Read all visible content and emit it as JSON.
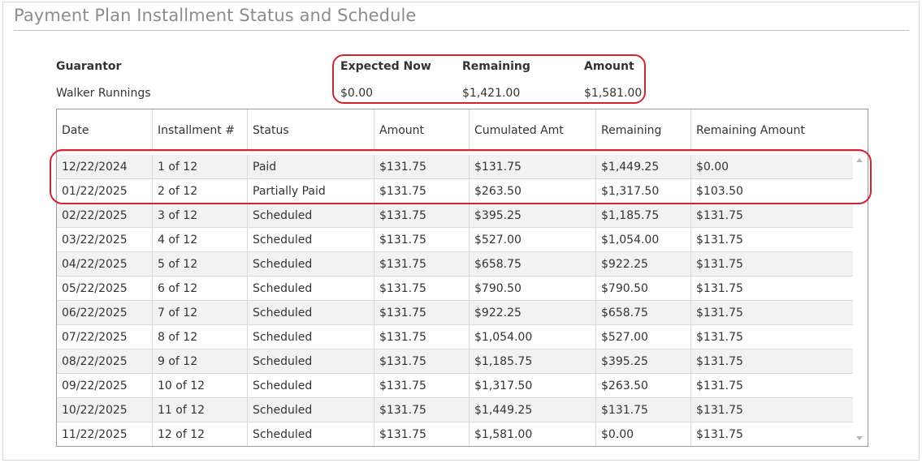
{
  "page": {
    "title": "Payment Plan Installment Status and Schedule"
  },
  "summary": {
    "guarantor_label": "Guarantor",
    "guarantor_value": "Walker Runnings",
    "expected_now_label": "Expected Now",
    "expected_now_value": "$0.00",
    "remaining_label": "Remaining",
    "remaining_value": "$1,421.00",
    "amount_label": "Amount",
    "amount_value": "$1,581.00"
  },
  "table": {
    "columns": [
      "Date",
      "Installment #",
      "Status",
      "Amount",
      "Cumulated Amt",
      "Remaining",
      "Remaining Amount"
    ],
    "rows": [
      [
        "12/22/2024",
        "1 of 12",
        "Paid",
        "$131.75",
        "$131.75",
        "$1,449.25",
        "$0.00"
      ],
      [
        "01/22/2025",
        "2 of 12",
        "Partially Paid",
        "$131.75",
        "$263.50",
        "$1,317.50",
        "$103.50"
      ],
      [
        "02/22/2025",
        "3 of 12",
        "Scheduled",
        "$131.75",
        "$395.25",
        "$1,185.75",
        "$131.75"
      ],
      [
        "03/22/2025",
        "4 of 12",
        "Scheduled",
        "$131.75",
        "$527.00",
        "$1,054.00",
        "$131.75"
      ],
      [
        "04/22/2025",
        "5 of 12",
        "Scheduled",
        "$131.75",
        "$658.75",
        "$922.25",
        "$131.75"
      ],
      [
        "05/22/2025",
        "6 of 12",
        "Scheduled",
        "$131.75",
        "$790.50",
        "$790.50",
        "$131.75"
      ],
      [
        "06/22/2025",
        "7 of 12",
        "Scheduled",
        "$131.75",
        "$922.25",
        "$658.75",
        "$131.75"
      ],
      [
        "07/22/2025",
        "8 of 12",
        "Scheduled",
        "$131.75",
        "$1,054.00",
        "$527.00",
        "$131.75"
      ],
      [
        "08/22/2025",
        "9 of 12",
        "Scheduled",
        "$131.75",
        "$1,185.75",
        "$395.25",
        "$131.75"
      ],
      [
        "09/22/2025",
        "10 of 12",
        "Scheduled",
        "$131.75",
        "$1,317.50",
        "$263.50",
        "$131.75"
      ],
      [
        "10/22/2025",
        "11 of 12",
        "Scheduled",
        "$131.75",
        "$1,449.25",
        "$131.75",
        "$131.75"
      ],
      [
        "11/22/2025",
        "12 of 12",
        "Scheduled",
        "$131.75",
        "$1,581.00",
        "$0.00",
        "$131.75"
      ]
    ]
  },
  "colors": {
    "annotation": "#d4232f",
    "title": "#8c8c8c",
    "row_alt": "#f2f2f2"
  }
}
